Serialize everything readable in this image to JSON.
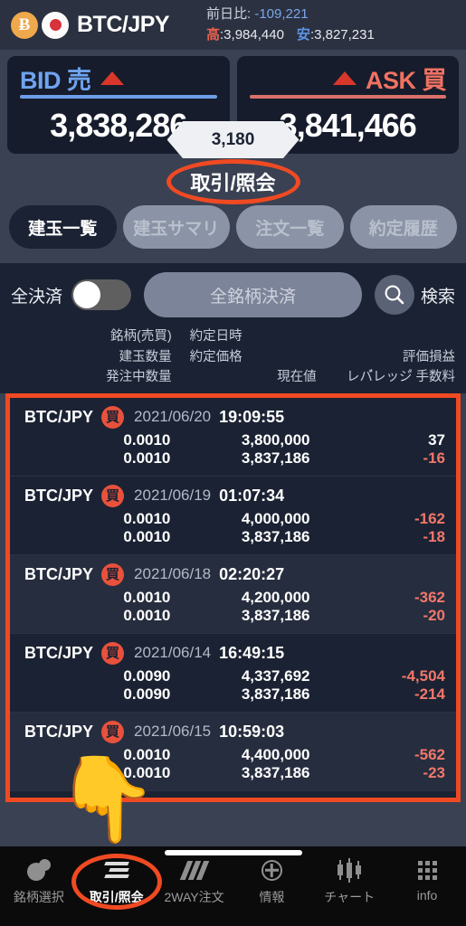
{
  "header": {
    "btc_symbol": "Ƀ",
    "pair": "BTC/JPY",
    "change_label": "前日比:",
    "change_value": "-109,221",
    "high_label": "高",
    "high_value": ":3,984,440",
    "low_label": "安",
    "low_value": ":3,827,231"
  },
  "quotes": {
    "bid_label": "BID 売",
    "bid_price": "3,838,286",
    "ask_label": "ASK 買",
    "ask_price": "3,841,466",
    "spread": "3,180"
  },
  "section": {
    "title": "取引/照会"
  },
  "tabs": [
    {
      "label": "建玉一覧",
      "active": true
    },
    {
      "label": "建玉サマリ",
      "active": false
    },
    {
      "label": "注文一覧",
      "active": false
    },
    {
      "label": "約定履歴",
      "active": false
    }
  ],
  "toolbar": {
    "all_settle_label": "全決済",
    "toggle_state": "off",
    "settle_all_button": "全銘柄決済",
    "search_label": "検索",
    "search_icon": "search-icon"
  },
  "column_headers": {
    "row1": {
      "c1": "銘柄(売買)",
      "c2": "約定日時",
      "c3": ""
    },
    "row2": {
      "c1": "建玉数量",
      "c2": "約定価格",
      "c3": "評価損益"
    },
    "row3": {
      "c1": "発注中数量",
      "c2": "現在値",
      "c3": "レバ゙レッジ゙ 手数料"
    }
  },
  "positions": [
    {
      "symbol": "BTC/JPY",
      "side": "買",
      "date": "2021/06/20",
      "time": "19:09:55",
      "qty": "0.0010",
      "price": "3,800,000",
      "pl": "37",
      "pl_sign": "pos",
      "pending_qty": "0.0010",
      "current": "3,837,186",
      "fee": "-16",
      "fee_sign": "neg"
    },
    {
      "symbol": "BTC/JPY",
      "side": "買",
      "date": "2021/06/19",
      "time": "01:07:34",
      "qty": "0.0010",
      "price": "4,000,000",
      "pl": "-162",
      "pl_sign": "neg",
      "pending_qty": "0.0010",
      "current": "3,837,186",
      "fee": "-18",
      "fee_sign": "neg"
    },
    {
      "symbol": "BTC/JPY",
      "side": "買",
      "date": "2021/06/18",
      "time": "02:20:27",
      "qty": "0.0010",
      "price": "4,200,000",
      "pl": "-362",
      "pl_sign": "neg",
      "pending_qty": "0.0010",
      "current": "3,837,186",
      "fee": "-20",
      "fee_sign": "neg"
    },
    {
      "symbol": "BTC/JPY",
      "side": "買",
      "date": "2021/06/14",
      "time": "16:49:15",
      "qty": "0.0090",
      "price": "4,337,692",
      "pl": "-4,504",
      "pl_sign": "neg",
      "pending_qty": "0.0090",
      "current": "3,837,186",
      "fee": "-214",
      "fee_sign": "neg"
    },
    {
      "symbol": "BTC/JPY",
      "side": "買",
      "date": "2021/06/15",
      "time": "10:59:03",
      "qty": "0.0010",
      "price": "4,400,000",
      "pl": "-562",
      "pl_sign": "neg",
      "pending_qty": "0.0010",
      "current": "3,837,186",
      "fee": "-23",
      "fee_sign": "neg"
    }
  ],
  "bottom_nav": [
    {
      "label": "銘柄選択",
      "icon": "circles-icon",
      "active": false
    },
    {
      "label": "取引/照会",
      "icon": "lines-icon",
      "active": true
    },
    {
      "label": "2WAY注文",
      "icon": "slashes-icon",
      "active": false
    },
    {
      "label": "情報",
      "icon": "crosshair-icon",
      "active": false
    },
    {
      "label": "チャート",
      "icon": "candlestick-icon",
      "active": false
    },
    {
      "label": "info",
      "icon": "grid-icon",
      "active": false
    }
  ],
  "annotations": {
    "hand_cursor": "👇"
  },
  "colors": {
    "accent_red": "#f04a23",
    "bid_blue": "#6fa4ef",
    "ask_red": "#f07263",
    "bg_panel": "#1b2233",
    "bg_app": "#3a4152"
  }
}
